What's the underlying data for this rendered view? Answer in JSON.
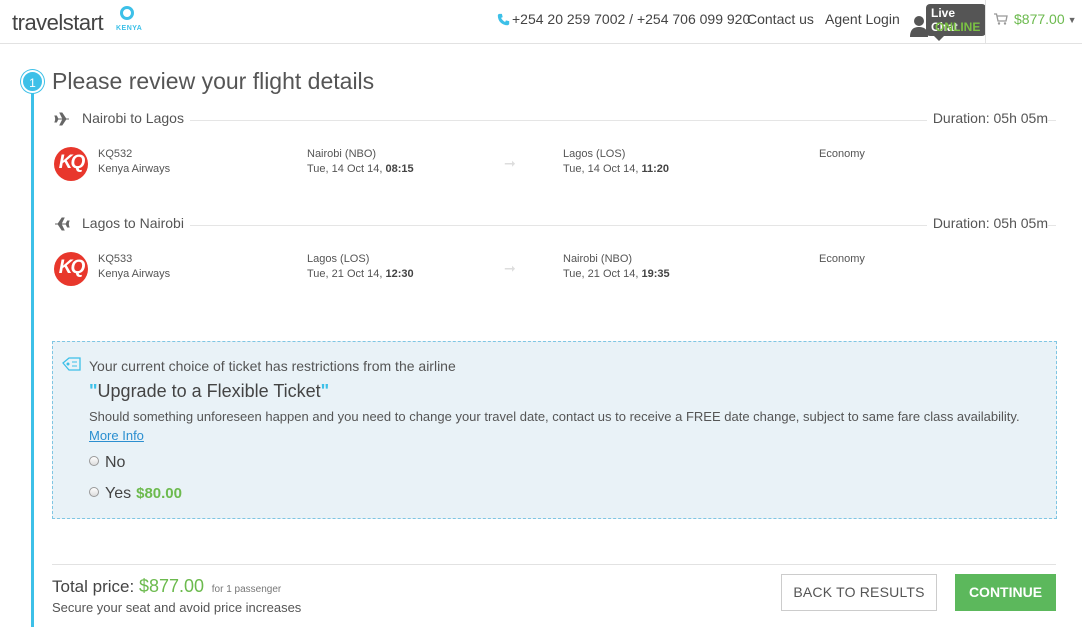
{
  "header": {
    "logo_text": "travelstart",
    "logo_sub": "KENYA",
    "phone": "+254 20 259 7002 / +254 706 099 920",
    "contact_label": "Contact us",
    "agent_label": "Agent Login",
    "live_chat_label": "Live Chat",
    "live_chat_status": "ONLINE",
    "cart_total": "$877.00"
  },
  "step": {
    "number": "1",
    "title": "Please review your flight details"
  },
  "legs": [
    {
      "route": "Nairobi to Lagos",
      "duration": "Duration: 05h 05m",
      "flight_no": "KQ532",
      "airline": "Kenya Airways",
      "dep_airport": "Nairobi (NBO)",
      "dep_date": "Tue, 14 Oct 14,",
      "dep_time": "08:15",
      "arr_airport": "Lagos (LOS)",
      "arr_date": "Tue, 14 Oct 14,",
      "arr_time": "11:20",
      "cabin": "Economy"
    },
    {
      "route": "Lagos to Nairobi",
      "duration": "Duration: 05h 05m",
      "flight_no": "KQ533",
      "airline": "Kenya Airways",
      "dep_airport": "Lagos (LOS)",
      "dep_date": "Tue, 21 Oct 14,",
      "dep_time": "12:30",
      "arr_airport": "Nairobi (NBO)",
      "arr_date": "Tue, 21 Oct 14,",
      "arr_time": "19:35",
      "cabin": "Economy"
    }
  ],
  "airline_logo_text": "KQ",
  "upgrade": {
    "restriction": "Your current choice of ticket has restrictions from the airline",
    "title": "Upgrade to a Flexible Ticket",
    "description": "Should something unforeseen happen and you need to change your travel date, contact us to receive a FREE date change, subject to same fare class availability.",
    "more_info": "More Info",
    "option_no": "No",
    "option_yes": "Yes",
    "option_yes_price": "$80.00"
  },
  "footer": {
    "total_label": "Total price:",
    "total_amount": "$877.00",
    "passengers": "for 1 passenger",
    "secure_text": "Secure your seat and avoid price increases",
    "back_label": "BACK TO RESULTS",
    "continue_label": "CONTINUE"
  },
  "colors": {
    "accent": "#3dc0e8",
    "price_green": "#6cba4e",
    "continue_green": "#5cb85c",
    "airline_red": "#e8372c"
  }
}
